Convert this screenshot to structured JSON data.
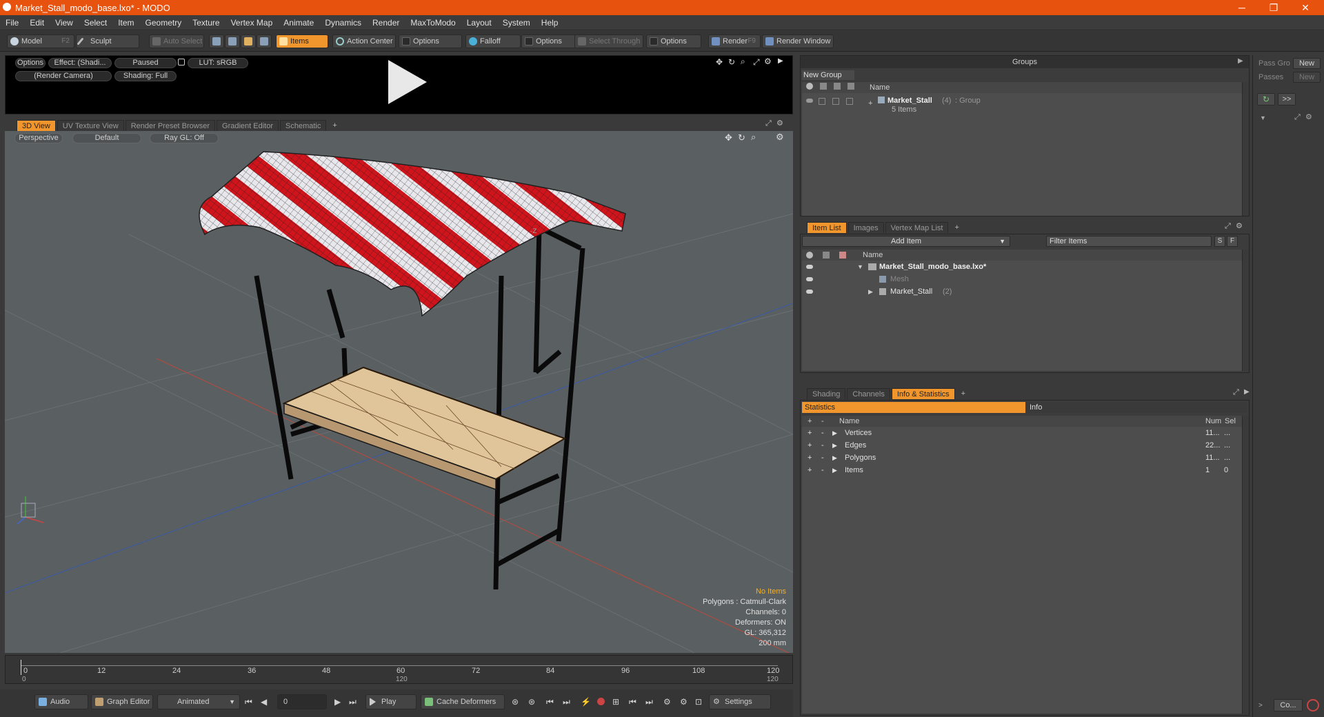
{
  "window": {
    "title": "Market_Stall_modo_base.lxo* - MODO",
    "minimize": "─",
    "maximize": "❐",
    "close": "✕"
  },
  "menu": [
    "File",
    "Edit",
    "View",
    "Select",
    "Item",
    "Geometry",
    "Texture",
    "Vertex Map",
    "Animate",
    "Dynamics",
    "Render",
    "MaxToModo",
    "Layout",
    "System",
    "Help"
  ],
  "toolbar": {
    "model": "Model",
    "model_key": "F2",
    "sculpt": "Sculpt",
    "auto_select": "Auto Select",
    "items": "Items",
    "action_center": "Action Center",
    "options1": "Options",
    "falloff": "Falloff",
    "options2": "Options",
    "select_through": "Select Through",
    "options3": "Options",
    "render": "Render",
    "render_key": "F9",
    "render_window": "Render Window"
  },
  "preview": {
    "options": "Options",
    "effect": "Effect: (Shadi...",
    "paused": "Paused",
    "lut": "LUT: sRGB",
    "camera": "(Render Camera)",
    "shading": "Shading: Full"
  },
  "viewport_tabs": [
    "3D View",
    "UV Texture View",
    "Render Preset Browser",
    "Gradient Editor",
    "Schematic"
  ],
  "viewport": {
    "perspective": "Perspective",
    "default": "Default",
    "raygl": "Ray GL: Off",
    "info": {
      "no_items": "No Items",
      "polygons": "Polygons : Catmull-Clark",
      "channels": "Channels: 0",
      "deformers": "Deformers: ON",
      "gl": "GL: 365,312",
      "scale": "200 mm"
    }
  },
  "timeline": {
    "ticks": [
      "0",
      "12",
      "24",
      "36",
      "48",
      "60",
      "72",
      "84",
      "96",
      "108",
      "120"
    ],
    "sub_left": "0",
    "sub_mid": "120",
    "sub_right": "120"
  },
  "bottom": {
    "audio": "Audio",
    "graph_editor": "Graph Editor",
    "animated": "Animated",
    "frame": "0",
    "play": "Play",
    "cache": "Cache Deformers",
    "settings": "Settings"
  },
  "groups": {
    "title": "Groups",
    "new_group": "New Group",
    "col_name": "Name",
    "item_name": "Market_Stall",
    "item_count": "(4)",
    "item_type": ": Group",
    "item_sub": "5 Items"
  },
  "right_strip": {
    "pass_group": "Pass Gro",
    "passes": "Passes",
    "new1": "New",
    "new2": "New",
    "more": ">>",
    "co": "Co..."
  },
  "item_list": {
    "tabs": [
      "Item List",
      "Images",
      "Vertex Map List"
    ],
    "add_item": "Add Item",
    "filter": "Filter Items",
    "s": "S",
    "f": "F",
    "col_name": "Name",
    "rows": [
      {
        "name": "Market_Stall_modo_base.lxo*"
      },
      {
        "name": "Mesh"
      },
      {
        "name": "Market_Stall",
        "count": "(2)"
      }
    ]
  },
  "stats": {
    "tabs": [
      "Shading",
      "Channels",
      "Info & Statistics"
    ],
    "statistics": "Statistics",
    "info": "Info",
    "col_name": "Name",
    "col_num": "Num",
    "col_sel": "Sel",
    "rows": [
      {
        "name": "Vertices",
        "num": "11...",
        "sel": "..."
      },
      {
        "name": "Edges",
        "num": "22...",
        "sel": "..."
      },
      {
        "name": "Polygons",
        "num": "11...",
        "sel": "..."
      },
      {
        "name": "Items",
        "num": "1",
        "sel": "0"
      }
    ]
  },
  "colors": {
    "accent": "#f0962c",
    "title_bar": "#e8520f",
    "awning_red": "#d0141c",
    "awning_white": "#e8e8ec",
    "wood": "#e0c49a"
  }
}
